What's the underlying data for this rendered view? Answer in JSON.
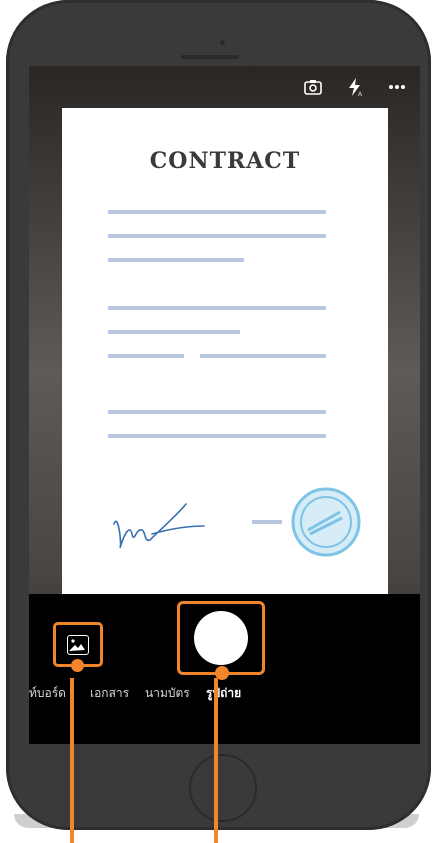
{
  "document": {
    "title": "CONTRACT"
  },
  "camera": {
    "modes": [
      {
        "label": "ท์บอร์ด"
      },
      {
        "label": "เอกสาร"
      },
      {
        "label": "นามบัตร"
      },
      {
        "label": "รูปถ่าย",
        "active": true
      }
    ]
  },
  "colors": {
    "highlight": "#f0852c",
    "doc_lines": "#b8c7de",
    "stamp": "#7fc4e6",
    "signature": "#3a6fb0"
  },
  "icons": [
    "flip-camera-icon",
    "flash-auto-icon",
    "more-icon",
    "gallery-icon"
  ]
}
